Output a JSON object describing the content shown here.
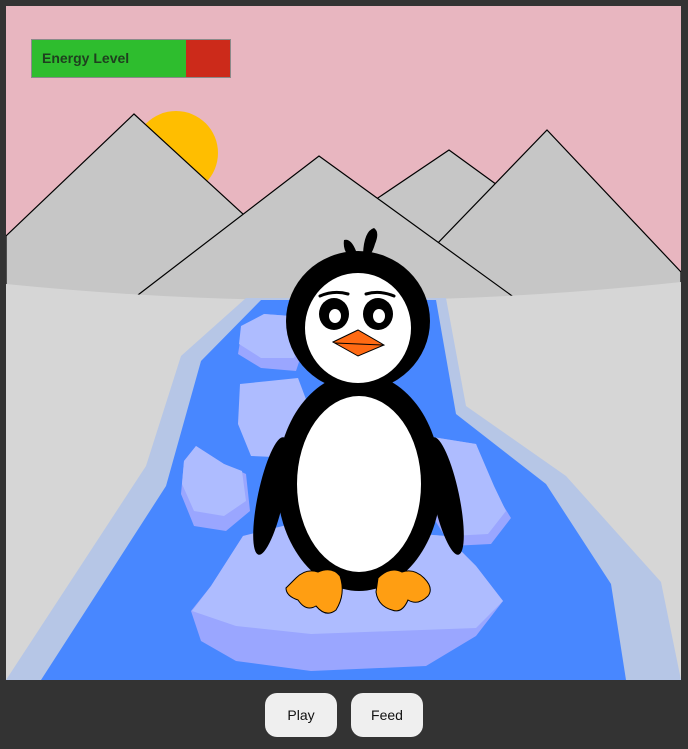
{
  "hud": {
    "energy_label": "Energy Level",
    "energy_level": 0.78,
    "energy_color": "#2ebd2e",
    "energy_empty_color": "#cc2a1a"
  },
  "controls": {
    "play_label": "Play",
    "feed_label": "Feed"
  },
  "scene": {
    "sky_color": "#e8b6c0",
    "sun_color": "#ffbe00",
    "mountain_color": "#c6c6c6",
    "snow_color": "#d6d6d6",
    "river_color": "#4887ff",
    "ice_color": "#a8b8ff"
  }
}
